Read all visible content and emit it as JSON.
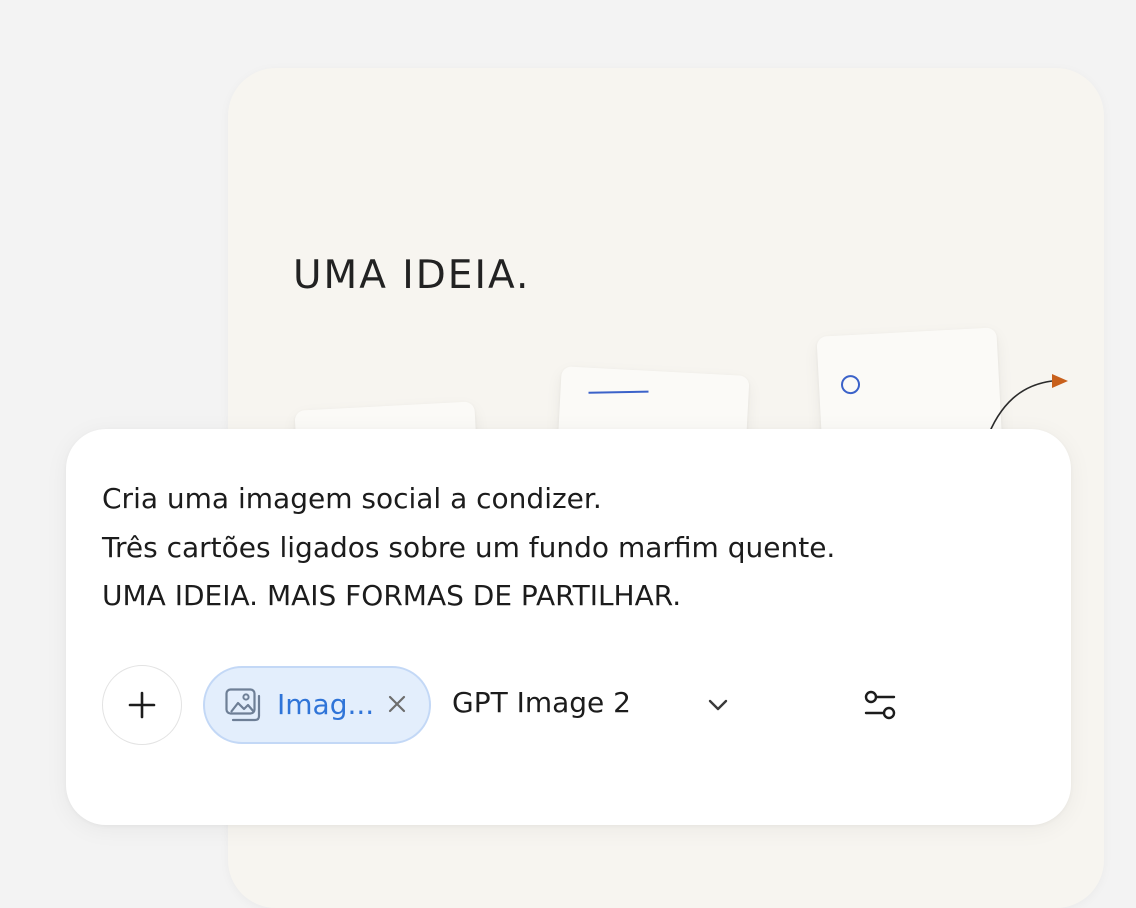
{
  "preview": {
    "headline": "UMA IDEIA."
  },
  "composer": {
    "prompt_lines": [
      "Cria uma imagem social a condizer.",
      "Três cartões ligados sobre um fundo marfim quente.",
      "UMA IDEIA. MAIS FORMAS DE PARTILHAR."
    ],
    "add_icon": "plus-icon",
    "attachment_chip": {
      "icon": "image-icon",
      "label": "Imag...",
      "close_icon": "close-icon"
    },
    "model_select": {
      "value": "GPT Image 2",
      "icon": "chevron-down-icon"
    },
    "settings_icon": "sliders-icon"
  },
  "colors": {
    "page_background": "#f3f3f3",
    "preview_background": "#f7f5f0",
    "chip_background": "#e3eefc",
    "chip_text": "#2f74d8",
    "accent_blue": "#3b62c9",
    "accent_orange": "#c8601c"
  }
}
